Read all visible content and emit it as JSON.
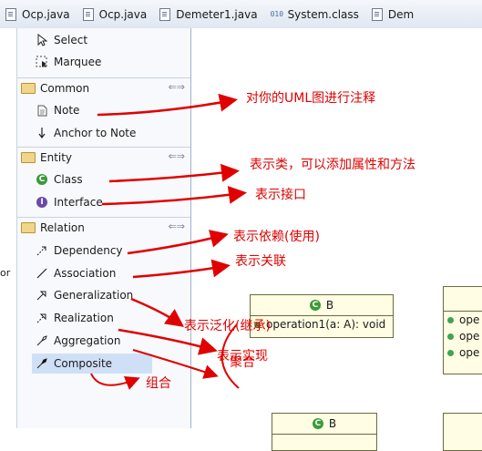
{
  "tabs": [
    {
      "label": "Ocp.java"
    },
    {
      "label": "Ocp.java"
    },
    {
      "label": "Demeter1.java"
    },
    {
      "label": "System.class"
    },
    {
      "label": "Dem"
    }
  ],
  "left_edge_text": "or",
  "palette": {
    "tools": [
      {
        "label": "Select",
        "icon": "arrow-cursor-icon"
      },
      {
        "label": "Marquee",
        "icon": "marquee-icon"
      }
    ],
    "drawers": [
      {
        "label": "Common",
        "items": [
          {
            "label": "Note",
            "icon": "note-icon"
          },
          {
            "label": "Anchor to Note",
            "icon": "anchor-arrow-icon"
          }
        ]
      },
      {
        "label": "Entity",
        "items": [
          {
            "label": "Class",
            "icon": "class-icon",
            "badge": "C",
            "color": "#3a9a3a"
          },
          {
            "label": "Interface",
            "icon": "interface-icon",
            "badge": "I",
            "color": "#6a4aa8"
          }
        ]
      },
      {
        "label": "Relation",
        "items": [
          {
            "label": "Dependency",
            "icon": "dependency-icon"
          },
          {
            "label": "Association",
            "icon": "association-icon"
          },
          {
            "label": "Generalization",
            "icon": "generalization-icon"
          },
          {
            "label": "Realization",
            "icon": "realization-icon"
          },
          {
            "label": "Aggregation",
            "icon": "aggregation-icon"
          },
          {
            "label": "Composite",
            "icon": "composite-icon",
            "selected": true
          }
        ]
      }
    ]
  },
  "canvas": {
    "class_b_top": {
      "name": "B",
      "operation": "operation1(a: A): void"
    },
    "class_right_ops": [
      "ope",
      "ope",
      "ope"
    ],
    "class_b_bottom": {
      "name": "B"
    }
  },
  "annotations": {
    "note": "对你的UML图进行注释",
    "class": "表示类，可以添加属性和方法",
    "interface": "表示接口",
    "dependency": "表示依赖(使用)",
    "association": "表示关联",
    "generalization": "表示泛化(继承)",
    "realization": "表示实现",
    "aggregation": "聚合",
    "composite": "组合"
  },
  "annotation_color": "#e00000"
}
